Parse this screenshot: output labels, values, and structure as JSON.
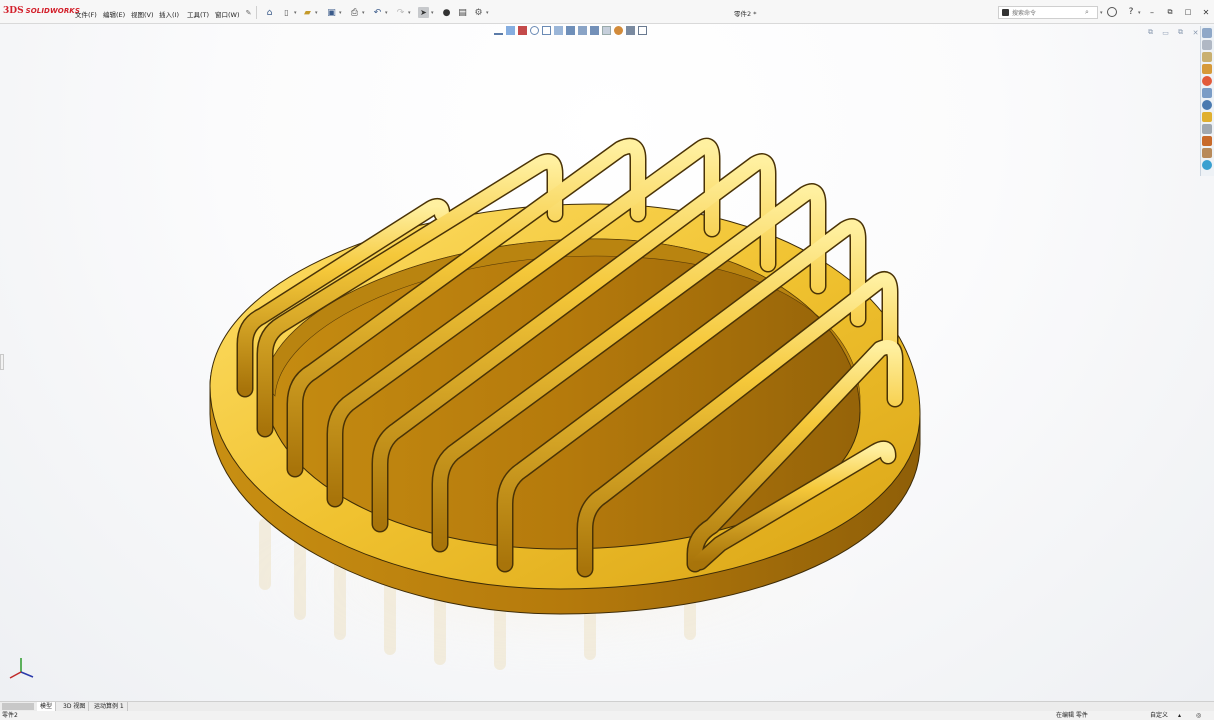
{
  "app": {
    "brand_ds": "3DS",
    "brand_name": "SOLIDWORKS",
    "document_title": "零件2 *"
  },
  "menu": [
    {
      "label": "文件(F)"
    },
    {
      "label": "编辑(E)"
    },
    {
      "label": "视图(V)"
    },
    {
      "label": "插入(I)"
    },
    {
      "label": "工具(T)"
    },
    {
      "label": "窗口(W)"
    }
  ],
  "search": {
    "placeholder": "搜索命令"
  },
  "tabs": [
    {
      "label": "模型",
      "active": true
    },
    {
      "label": "3D 视图",
      "active": false
    },
    {
      "label": "运动算例 1",
      "active": false
    }
  ],
  "status": {
    "left": "零件2",
    "editing": "在编辑 零件",
    "custom": "自定义"
  },
  "colors": {
    "gold_light": "#ffd84a",
    "gold_mid": "#e2ad18",
    "gold_dark": "#8a5b08",
    "brand_red": "#d3202b"
  }
}
